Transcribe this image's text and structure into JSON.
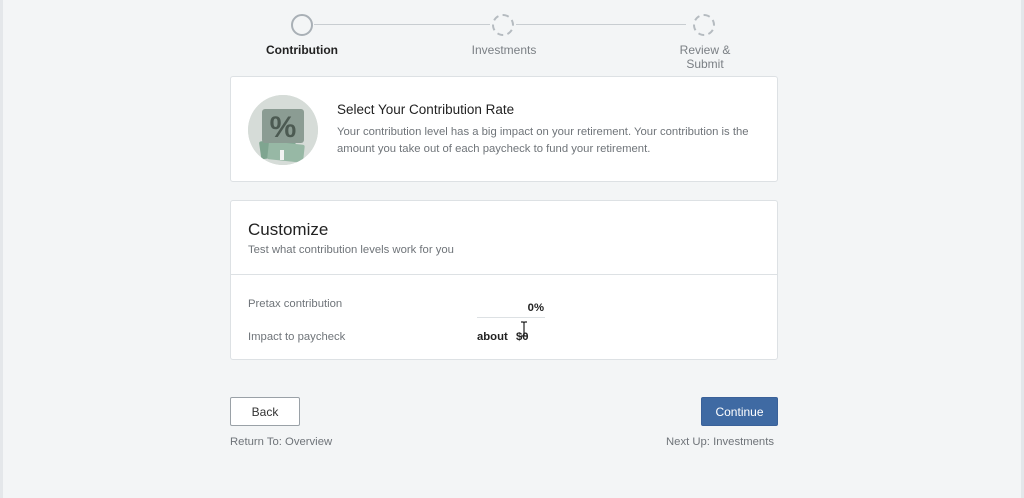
{
  "stepper": {
    "steps": [
      {
        "label": "Contribution",
        "state": "active"
      },
      {
        "label": "Investments",
        "state": "pending"
      },
      {
        "label": "Review & Submit",
        "label_line1": "Review &",
        "label_line2": "Submit",
        "state": "pending"
      }
    ]
  },
  "intro": {
    "icon": "percent-money-icon",
    "title": "Select Your Contribution Rate",
    "text": "Your contribution level has a big impact on your retirement. Your contribution is the amount you take out of each paycheck to fund your retirement."
  },
  "customize": {
    "title": "Customize",
    "subtitle": "Test what contribution levels work for you",
    "pretax_label": "Pretax contribution",
    "pretax_value": "0%",
    "impact_label": "Impact to paycheck",
    "impact_prefix": "about",
    "impact_value": "$0"
  },
  "footer": {
    "back_label": "Back",
    "continue_label": "Continue",
    "return_text": "Return To: Overview",
    "next_text": "Next Up: Investments"
  },
  "colors": {
    "background": "#f3f5f6",
    "primary_button": "#3f6aa3",
    "card_border": "#dde1e4"
  }
}
